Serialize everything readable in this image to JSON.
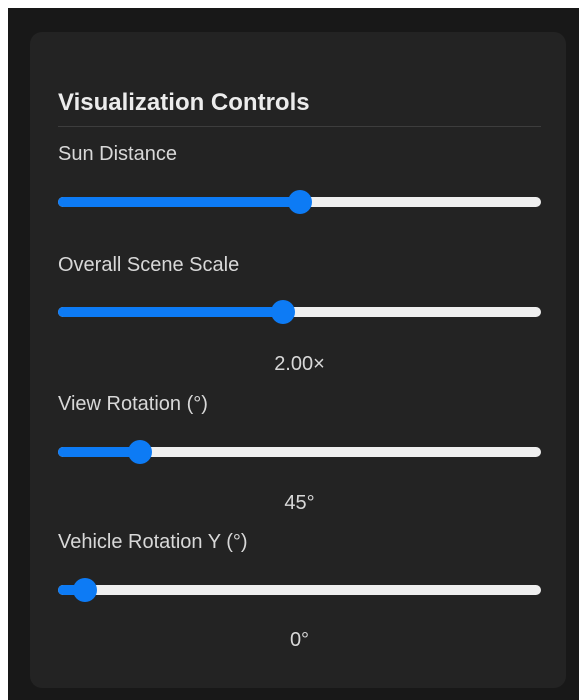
{
  "panel": {
    "title": "Visualization Controls"
  },
  "controls": [
    {
      "label": "Sun Distance",
      "value_text": "",
      "level": 0.5
    },
    {
      "label": "Overall Scene Scale",
      "value_text": "2.00×",
      "level": 0.465
    },
    {
      "label": "View Rotation (°)",
      "value_text": "45°",
      "level": 0.17
    },
    {
      "label": "Vehicle Rotation Y (°)",
      "value_text": "0°",
      "level": 0.055
    }
  ],
  "colors": {
    "accent": "#0d7bf5",
    "track": "#efefef",
    "panel_bg": "#232323",
    "page_bg": "#181818",
    "text": "#d8d8d8"
  }
}
